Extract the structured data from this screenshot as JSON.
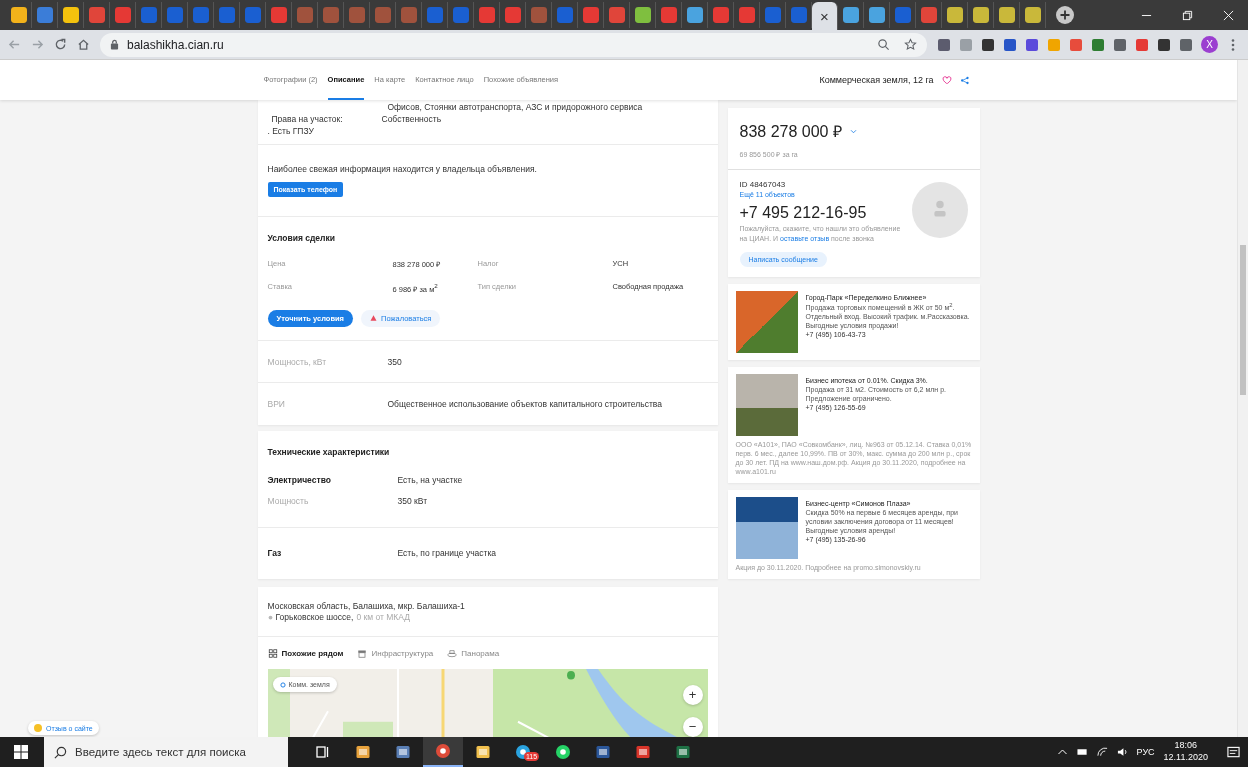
{
  "browser": {
    "tabs": [
      {
        "color": "#f2b21b",
        "selected": false
      },
      {
        "color": "#3b7dd8",
        "selected": false
      },
      {
        "color": "#f4c20d",
        "selected": false
      },
      {
        "color": "#e0453a",
        "selected": false
      },
      {
        "color": "#e53935",
        "selected": false
      },
      {
        "color": "#1a5fd1",
        "selected": false
      },
      {
        "color": "#1a5fd1",
        "selected": false
      },
      {
        "color": "#1a5fd1",
        "selected": false
      },
      {
        "color": "#1a5fd1",
        "selected": false
      },
      {
        "color": "#1a5fd1",
        "selected": false
      },
      {
        "color": "#e53935",
        "selected": false
      },
      {
        "color": "#a0523d",
        "selected": false
      },
      {
        "color": "#a0523d",
        "selected": false
      },
      {
        "color": "#a0523d",
        "selected": false
      },
      {
        "color": "#a0523d",
        "selected": false
      },
      {
        "color": "#a0523d",
        "selected": false
      },
      {
        "color": "#1a5fd1",
        "selected": false
      },
      {
        "color": "#1a5fd1",
        "selected": false
      },
      {
        "color": "#e53935",
        "selected": false
      },
      {
        "color": "#e53935",
        "selected": false
      },
      {
        "color": "#a0523d",
        "selected": false
      },
      {
        "color": "#1a5fd1",
        "selected": false
      },
      {
        "color": "#e53935",
        "selected": false
      },
      {
        "color": "#e0453a",
        "selected": false
      },
      {
        "color": "#7fbf3f",
        "selected": false
      },
      {
        "color": "#e53935",
        "selected": false
      },
      {
        "color": "#4aa3df",
        "selected": false
      },
      {
        "color": "#e53935",
        "selected": false
      },
      {
        "color": "#e53935",
        "selected": false
      },
      {
        "color": "#1a5fd1",
        "selected": false
      },
      {
        "color": "#1a5fd1",
        "selected": false
      },
      {
        "selected": true
      },
      {
        "color": "#4aa3df",
        "selected": false
      },
      {
        "color": "#4aa3df",
        "selected": false
      },
      {
        "color": "#1a5fd1",
        "selected": false
      },
      {
        "color": "#e0453a",
        "selected": false
      },
      {
        "color": "#c9b83a",
        "selected": false
      },
      {
        "color": "#c9b83a",
        "selected": false
      },
      {
        "color": "#c9b83a",
        "selected": false
      },
      {
        "color": "#c9b83a",
        "selected": false
      }
    ],
    "close_glyph": "×",
    "url": "balashikha.cian.ru",
    "extensions": [
      {
        "color": "#5c5c6e"
      },
      {
        "color": "#9aa0a6"
      },
      {
        "color": "#333333"
      },
      {
        "color": "#2755c7"
      },
      {
        "color": "#5b4bdb"
      },
      {
        "color": "#f0a500"
      },
      {
        "color": "#e74c3c"
      },
      {
        "color": "#2e7d32"
      },
      {
        "color": "#5f6368"
      },
      {
        "color": "#e53935"
      },
      {
        "color": "#333333"
      },
      {
        "color": "#5f6368"
      }
    ],
    "profile_initial": "X"
  },
  "page_nav": {
    "tabs": [
      {
        "label": "Фотографии (2)",
        "selected": false
      },
      {
        "label": "Описание",
        "selected": true
      },
      {
        "label": "На карте",
        "selected": false
      },
      {
        "label": "Контактное лицо",
        "selected": false
      },
      {
        "label": "Похожие объявления",
        "selected": false
      }
    ],
    "title": "Коммерческая земля, 12 га"
  },
  "details": {
    "purpose_tail": "Офисов, Стоянки автотранспорта, АЗС и придорожного сервиса",
    "rights_label": "Права на участок:",
    "rights_value": "Собственность",
    "gpzu": ". Есть ГПЗУ"
  },
  "owner_info": {
    "text": "Наиболее свежая информация находится у владельца объявления.",
    "button": "Показать телефон"
  },
  "deal": {
    "title": "Условия сделки",
    "rows": [
      {
        "label": "Цена",
        "value": "838 278 000 ₽",
        "label2": "Налог",
        "value2": "УСН"
      },
      {
        "label": "Ставка",
        "value": "6 986 ₽ за м$^{2}$",
        "label2": "Тип сделки",
        "value2": "Свободная продажа"
      }
    ],
    "primary_button": "Уточнить условия",
    "complaint_button": "Пожаловаться"
  },
  "params": [
    {
      "label": "Мощность, кВт",
      "value": "350"
    },
    {
      "label": "ВРИ",
      "value": "Общественное использование объектов капитального строительства"
    }
  ],
  "tech": {
    "title": "Технические характеристики",
    "groups": [
      {
        "rows": [
          {
            "kind": "main",
            "label": "Электричество",
            "value": "Есть, на участке"
          },
          {
            "kind": "sub",
            "label": "Мощность",
            "value": "350 кВт"
          }
        ]
      },
      {
        "rows": [
          {
            "kind": "main",
            "label": "Газ",
            "value": "Есть, по границе участка"
          }
        ]
      }
    ]
  },
  "address": {
    "line": "Московская область, Балашиха, мкр. Балашиха-1",
    "highway": "Горьковское шоссе,",
    "distance": "0 км от МКАД"
  },
  "map": {
    "tabs": [
      {
        "kind": "grid",
        "label": "Похожие рядом",
        "selected": true
      },
      {
        "kind": "building",
        "label": "Инфраструктура",
        "selected": false
      },
      {
        "kind": "panorama",
        "label": "Панорама",
        "selected": false
      }
    ],
    "filter_chip": "Комм. земля",
    "zoom_in": "+",
    "zoom_out": "−"
  },
  "price_card": {
    "price": "838 278 000 ₽",
    "per_unit": "69 856 500 ₽ за га",
    "id": "ID 48467043",
    "more_objects": "Ещё 11 объектов",
    "phone": "+7 495 212-16-95",
    "note_before": "Пожалуйста, скажите, что нашли это объявление на ЦИАН. И",
    "note_link": "оставьте отзыв",
    "note_after": "после звонка",
    "message_button": "Написать сообщение"
  },
  "ads": [
    {
      "title": "Город-Парк «Переделкино Ближнее»",
      "text": "Продажа торговых помещений в ЖК от 50 м$^{2}$. Отдельный вход. Высокий трафик. м.Рассказовка. Выгодные условия продажи!",
      "phone": "+7 (495) 106-43-73"
    },
    {
      "title": "Бизнес ипотека от 0.01%. Скидка 3%.",
      "text": "Продажа от 31 м2. Стоимость от 6,2 млн р. Предложение ограничено.",
      "phone": "+7 (495) 126-55-69",
      "disclaimer": "ООО «А101», ПАО «Совкомбанк», лиц. №963 от 05.12.14. Ставка 0,01% перв. 6 мес., далее 10,99%. ПВ от 30%, макс. сумма до 200 млн р., срок до 30 лет. ПД на www.наш.дом.рф. Акция до 30.11.2020, подробнее на www.a101.ru"
    },
    {
      "title": "Бизнес-центр «Симонов Плаза»",
      "text": "Скидка 50% на первые 6 месяцев аренды, при условии заключения договора от 11 месяцев! Выгодные условия аренды!",
      "phone": "+7 (495) 135-26-96",
      "disclaimer": "Акция до 30.11.2020. Подробнее на promo.simonovskiy.ru"
    }
  ],
  "feedback": "Отзыв о сайте",
  "taskbar": {
    "search_placeholder": "Введите здесь текст для поиска",
    "apps": [
      {
        "kind": "taskview",
        "active": false
      },
      {
        "kind": "paint",
        "active": false
      },
      {
        "kind": "calculator",
        "active": false
      },
      {
        "kind": "chrome",
        "active": true
      },
      {
        "kind": "folder",
        "active": false
      },
      {
        "kind": "telegram",
        "active": false,
        "badge": "115"
      },
      {
        "kind": "whatsapp",
        "active": false
      },
      {
        "kind": "word",
        "active": false
      },
      {
        "kind": "pdf",
        "active": false
      },
      {
        "kind": "excel",
        "active": false
      }
    ],
    "language": "РУС",
    "time": "18:06",
    "date": "12.11.2020"
  }
}
